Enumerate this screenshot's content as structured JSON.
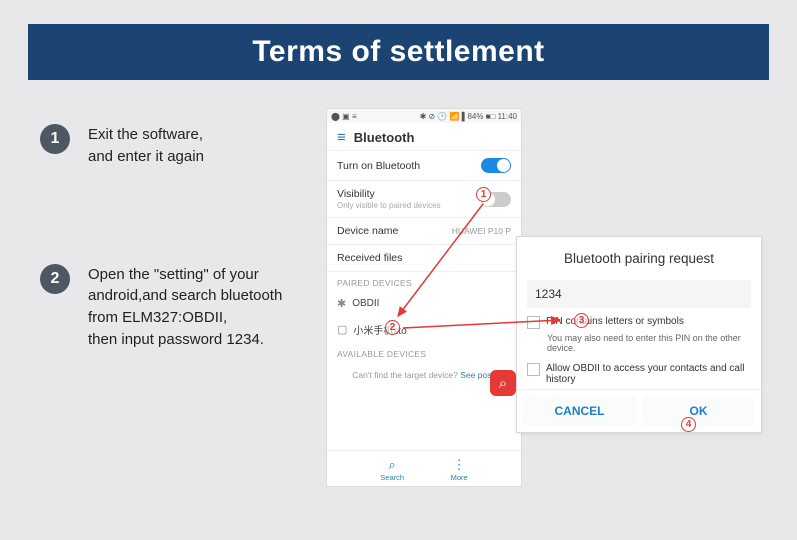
{
  "header": {
    "title": "Terms of settlement"
  },
  "steps": [
    {
      "num": "1",
      "text": "Exit the software,\nand enter it again"
    },
    {
      "num": "2",
      "text": "Open the \"setting\" of your android,and search bluetooth from ELM327:OBDII,\nthen input password 1234."
    }
  ],
  "phone": {
    "status_left": "⬤ ▣ ≡",
    "status_right": "✱ ⊘ 🕑 📶 ▌84% ■□ 11:40",
    "title": "Bluetooth",
    "rows": {
      "toggle": "Turn on Bluetooth",
      "visibility": "Visibility",
      "visibility_sub": "Only visible to paired devices",
      "device_name": "Device name",
      "device_name_val": "HUAWEI P10 P",
      "received": "Received files"
    },
    "paired_head": "PAIRED DEVICES",
    "paired": [
      {
        "icon": "✱",
        "name": "OBDII"
      },
      {
        "icon": "▢",
        "name": "小米手机sto"
      }
    ],
    "avail_head": "AVAILABLE DEVICES",
    "avail_text": "Can't find the target device? ",
    "avail_link": "See poss",
    "nav_search": "Search",
    "nav_more": "More"
  },
  "dialog": {
    "title": "Bluetooth pairing request",
    "pin": "1234",
    "opt1": "PIN contains letters or symbols",
    "sub1": "You may also need to enter this PIN on the other device.",
    "opt2": "Allow OBDII to access your contacts and call history",
    "cancel": "CANCEL",
    "ok": "OK"
  },
  "annotations": {
    "a1": "1",
    "a2": "2",
    "a3": "3",
    "a4": "4"
  }
}
